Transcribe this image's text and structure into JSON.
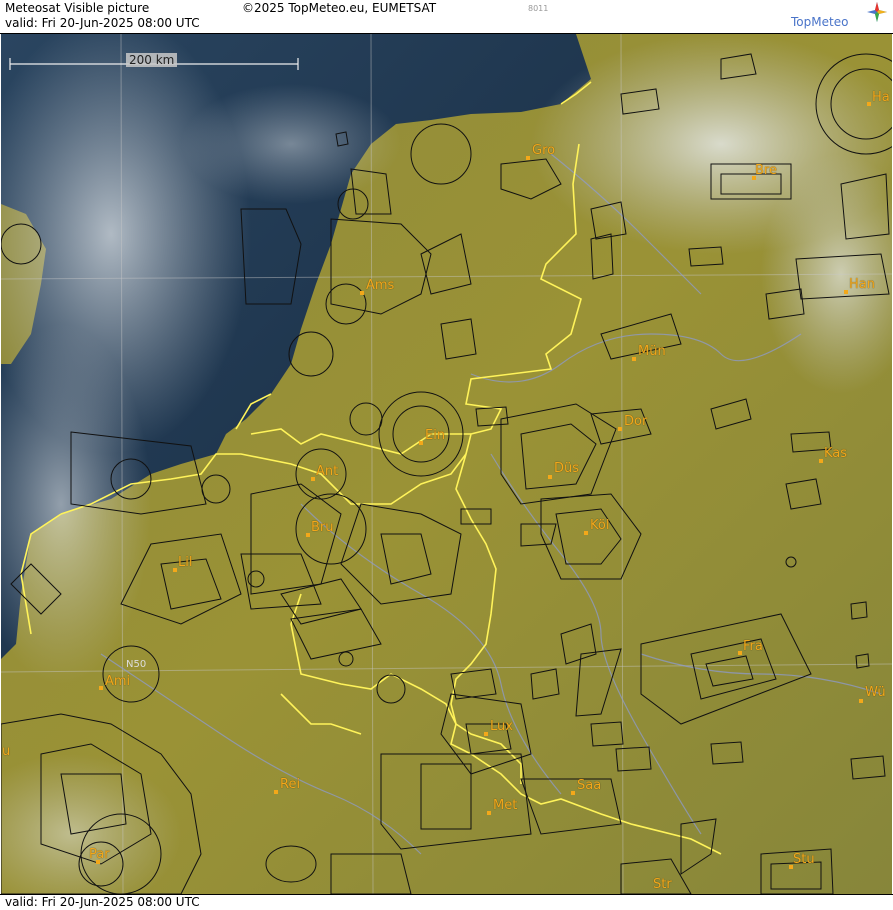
{
  "header": {
    "title": "Meteosat Visible picture",
    "copyright": "©2025 TopMeteo.eu, EUMETSAT",
    "valid": "valid:  Fri  20-Jun-2025  08:00 UTC",
    "code": "8011",
    "logo_text": "TopMeteo",
    "logo_icon": "compass-star-icon"
  },
  "footer": {
    "valid": "valid:  Fri  20-Jun-2025  08:00 UTC"
  },
  "scale": {
    "label": "200 km"
  },
  "cities": {
    "gro": "Gro",
    "bre": "Bre",
    "ha": "Ha",
    "ams": "Ams",
    "han": "Han",
    "mun": "Mün",
    "ein": "Ein",
    "dor": "Dor",
    "ant": "Ant",
    "dus": "Düs",
    "kas": "Kas",
    "bru": "Bru",
    "kol": "Köl",
    "lil": "Lil",
    "fra": "Fra",
    "ami": "Ami",
    "wu": "Wü",
    "lux": "Lux",
    "u": "u",
    "rei": "Rei",
    "saa": "Saa",
    "met": "Met",
    "par": "Par",
    "stu": "Stu",
    "str": "Str"
  },
  "grid_label": "N50",
  "colors": {
    "sea": "#1f3550",
    "land": "#9a9236",
    "border": "#fff35a",
    "airspace": "#111111",
    "city": "#f3a81a",
    "cloud": "#d9dde2"
  }
}
